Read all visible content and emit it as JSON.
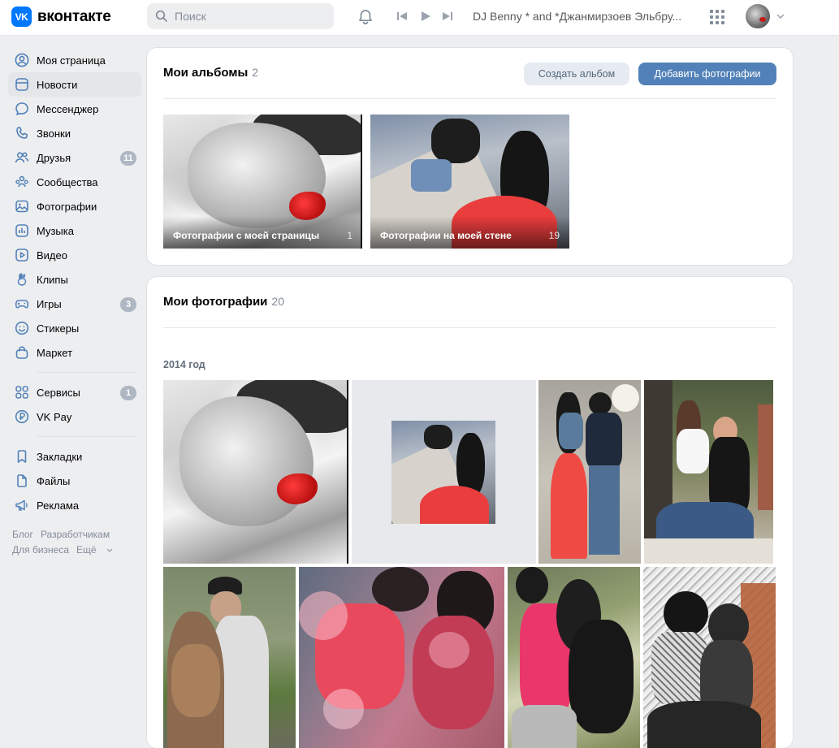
{
  "header": {
    "logo_text": "вконтакте",
    "logo_mark": "VK",
    "search_placeholder": "Поиск",
    "now_playing": "DJ Benny * and *Джанмирзоев Эльбру..."
  },
  "sidebar": {
    "items": [
      {
        "label": "Моя страница",
        "icon": "user-circle-icon"
      },
      {
        "label": "Новости",
        "icon": "news-icon"
      },
      {
        "label": "Мессенджер",
        "icon": "message-icon"
      },
      {
        "label": "Звонки",
        "icon": "phone-icon"
      },
      {
        "label": "Друзья",
        "icon": "friends-icon",
        "badge": "11"
      },
      {
        "label": "Сообщества",
        "icon": "communities-icon"
      },
      {
        "label": "Фотографии",
        "icon": "photo-icon"
      },
      {
        "label": "Музыка",
        "icon": "music-icon"
      },
      {
        "label": "Видео",
        "icon": "video-icon"
      },
      {
        "label": "Клипы",
        "icon": "clips-icon"
      },
      {
        "label": "Игры",
        "icon": "games-icon",
        "badge": "3"
      },
      {
        "label": "Стикеры",
        "icon": "smile-icon"
      },
      {
        "label": "Маркет",
        "icon": "market-icon"
      }
    ],
    "items2": [
      {
        "label": "Сервисы",
        "icon": "services-icon",
        "badge": "1"
      },
      {
        "label": "VK Pay",
        "icon": "vkpay-icon"
      }
    ],
    "items3": [
      {
        "label": "Закладки",
        "icon": "bookmark-icon"
      },
      {
        "label": "Файлы",
        "icon": "file-icon"
      },
      {
        "label": "Реклама",
        "icon": "ads-icon"
      }
    ],
    "footer": {
      "blog": "Блог",
      "developers": "Разработчикам",
      "business": "Для бизнеса",
      "more": "Ещё"
    }
  },
  "albums_card": {
    "title": "Мои альбомы",
    "count": "2",
    "create_button": "Создать альбом",
    "add_button": "Добавить фотографии",
    "albums": [
      {
        "name": "Фотографии с моей страницы",
        "count": "1"
      },
      {
        "name": "Фотографии на моей стене",
        "count": "19"
      }
    ]
  },
  "photos_card": {
    "title": "Мои фотографии",
    "count": "20",
    "year": "2014 год"
  },
  "colors": {
    "accent": "#0077ff",
    "primary_button": "#5181b8",
    "secondary_button": "#e5ebf1",
    "background": "#edeef0",
    "badge": "#aeb7c2"
  }
}
